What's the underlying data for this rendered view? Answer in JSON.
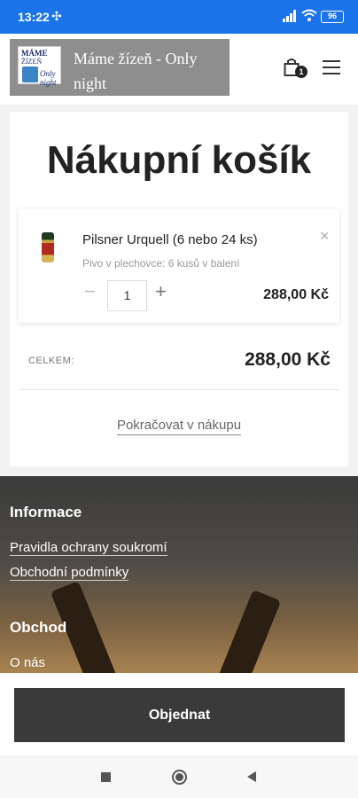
{
  "status_bar": {
    "time": "13:22",
    "battery": "96"
  },
  "header": {
    "logo_lines": [
      "MÁME",
      "ŽÍZEŇ",
      "Only night"
    ],
    "site_title": "Máme žízeň - Only night",
    "cart_count": "1"
  },
  "cart": {
    "title": "Nákupní košík",
    "items": [
      {
        "name": "Pilsner Urquell (6 nebo 24 ks)",
        "description": "Pivo v plechovce: 6 kusů v balení",
        "quantity": "1",
        "price": "288,00 Kč",
        "remove_label": "×",
        "minus_label": "−",
        "plus_label": "+"
      }
    ],
    "total_label": "CELKEM:",
    "total_value": "288,00 Kč",
    "continue_label": "Pokračovat v nákupu"
  },
  "footer": {
    "info_heading": "Informace",
    "info_links": [
      "Pravidla ochrany soukromí",
      "Obchodní podmínky"
    ],
    "shop_heading": "Obchod",
    "shop_links": [
      "O nás"
    ]
  },
  "order_button": "Objednat",
  "icons": [
    "signal-icon",
    "wifi-icon",
    "battery-icon",
    "cart-icon",
    "menu-icon",
    "close-icon",
    "minus-icon",
    "plus-icon"
  ]
}
